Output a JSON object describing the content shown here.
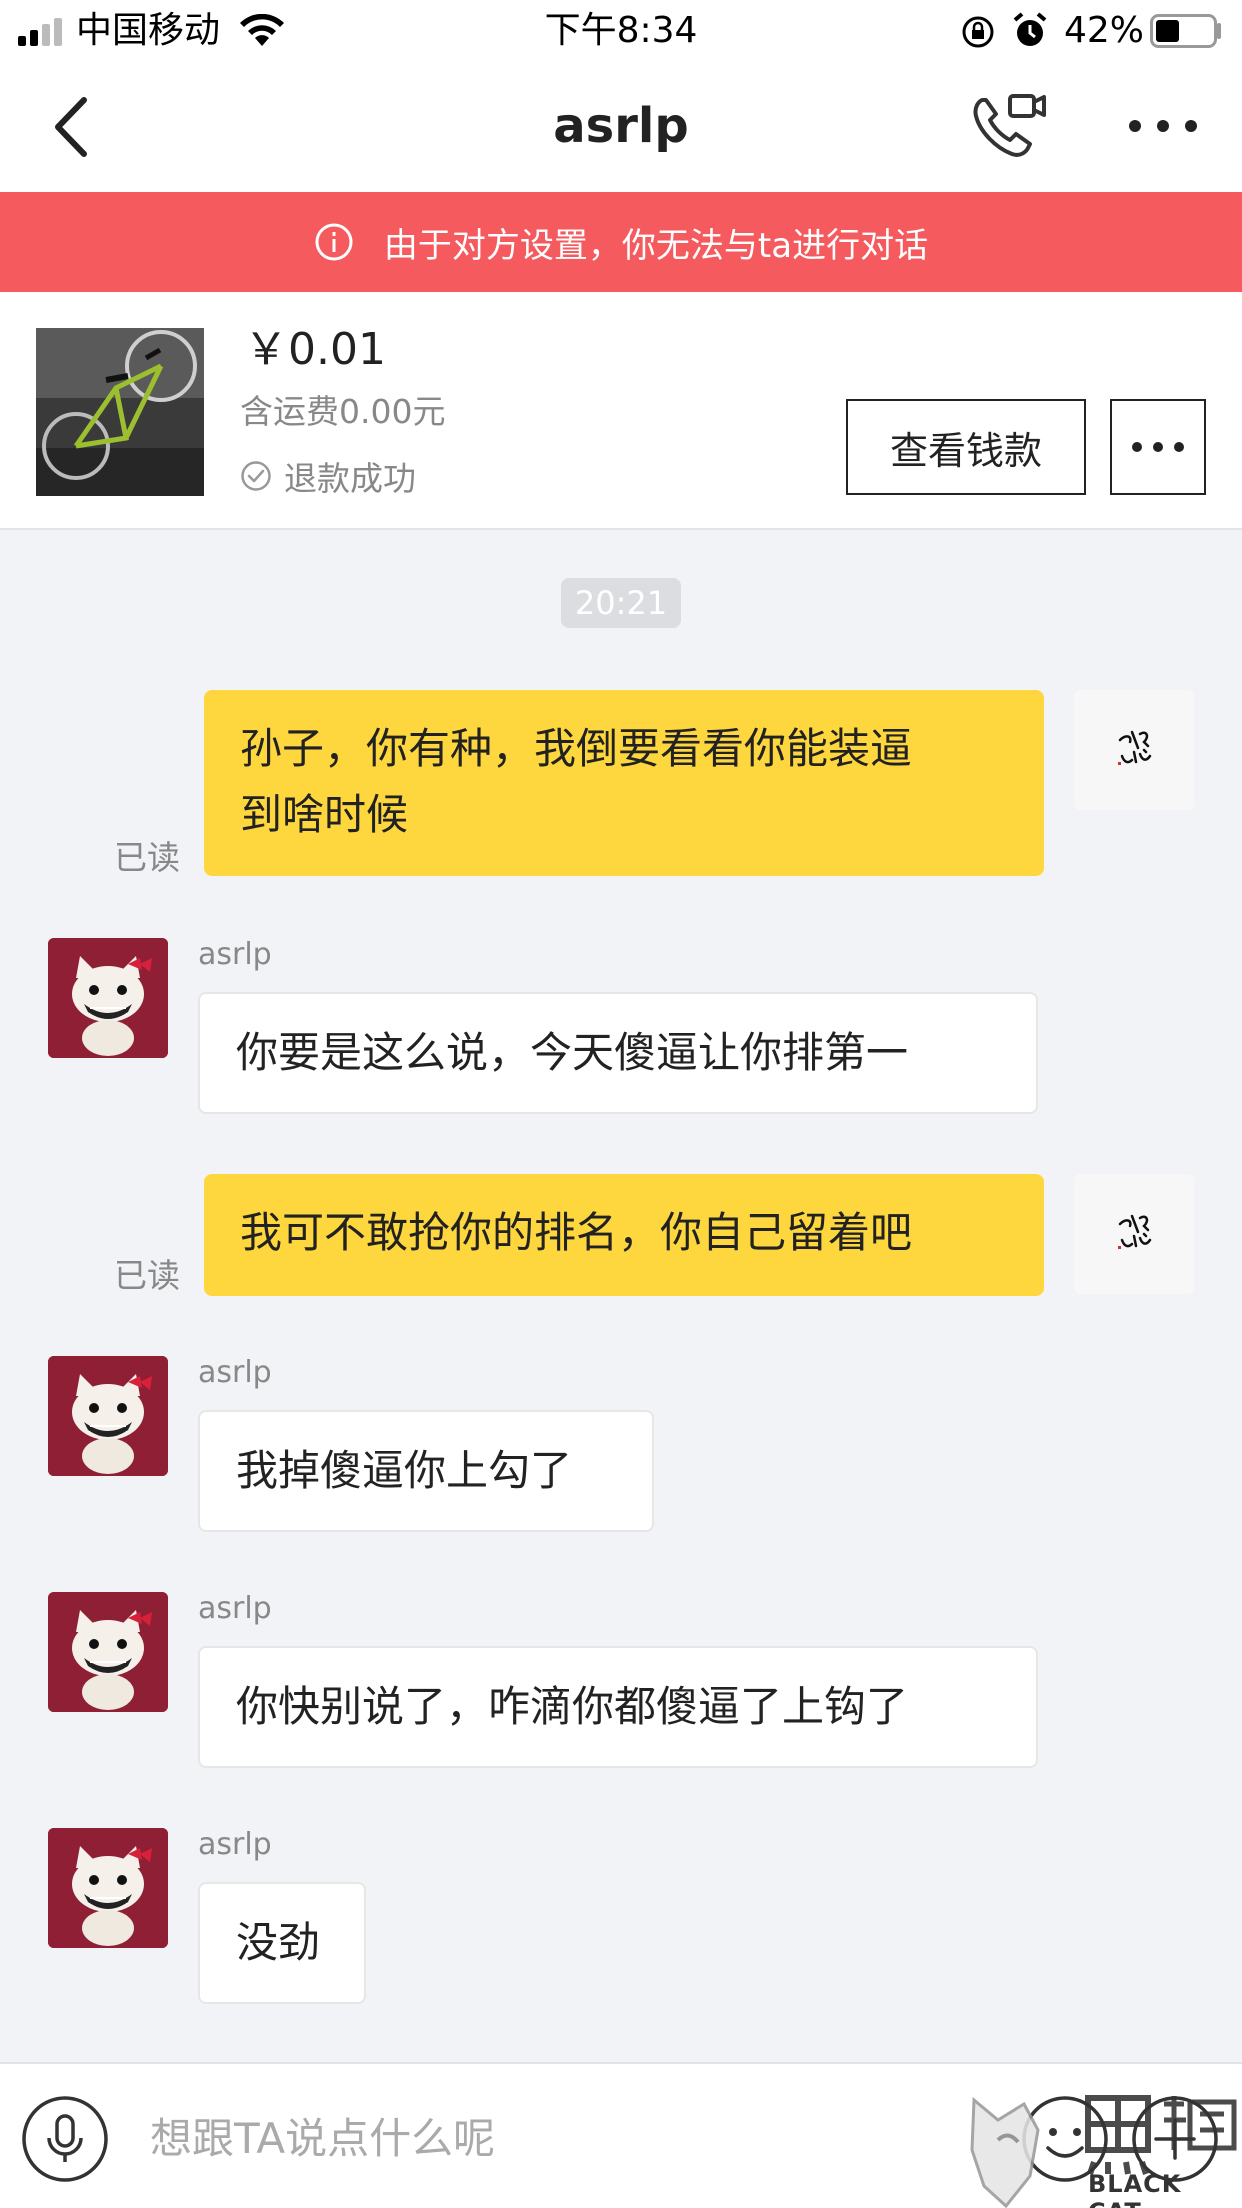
{
  "status_bar": {
    "carrier": "中国移动",
    "time": "下午8:34",
    "battery_percent": "42%",
    "battery_level": 0.42
  },
  "nav": {
    "title": "asrlp"
  },
  "banner": {
    "text": "由于对方设置，你无法与ta进行对话",
    "color": "#f55a5f"
  },
  "product": {
    "price": "￥0.01",
    "shipping": "含运费0.00元",
    "status": "退款成功",
    "view_button": "查看钱款"
  },
  "chat": {
    "timestamp": "20:21",
    "read_label": "已读",
    "messages": [
      {
        "from": "self",
        "lines": [
          "孙子，你有种，我倒要看看你能装逼",
          "到啥时候"
        ]
      },
      {
        "from": "other",
        "sender": "asrlp",
        "text": "你要是这么说，今天傻逼让你排第一"
      },
      {
        "from": "self",
        "text": "我可不敢抢你的排名，你自己留着吧"
      },
      {
        "from": "other",
        "sender": "asrlp",
        "text": "我掉傻逼你上勾了"
      },
      {
        "from": "other",
        "sender": "asrlp",
        "text": "你快别说了，咋滴你都傻逼了上钩了"
      },
      {
        "from": "other",
        "sender": "asrlp",
        "text": "没劲"
      }
    ],
    "self_bubble_color": "#fed63e"
  },
  "input": {
    "placeholder": "想跟TA说点什么呢"
  },
  "watermark": {
    "text": "BLACK CAT"
  },
  "icons": [
    "signal-icon",
    "wifi-icon",
    "rotation-lock-icon",
    "alarm-icon",
    "battery-icon",
    "back-icon",
    "video-call-icon",
    "more-icon",
    "info-icon",
    "check-circle-icon",
    "microphone-icon",
    "emoji-icon",
    "plus-icon"
  ]
}
